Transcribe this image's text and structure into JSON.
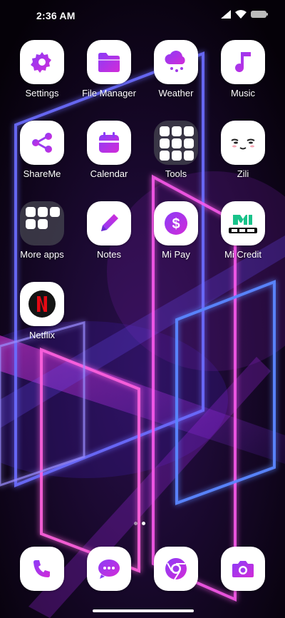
{
  "status_bar": {
    "time": "2:36 AM"
  },
  "apps": [
    {
      "label": "Settings",
      "icon": "gear-icon"
    },
    {
      "label": "File Manager",
      "icon": "folder-icon"
    },
    {
      "label": "Weather",
      "icon": "cloud-rain-icon"
    },
    {
      "label": "Music",
      "icon": "music-note-icon"
    },
    {
      "label": "ShareMe",
      "icon": "share-icon"
    },
    {
      "label": "Calendar",
      "icon": "calendar-icon"
    },
    {
      "label": "Tools",
      "icon": "folder-icon"
    },
    {
      "label": "Zili",
      "icon": "smiley-face-icon"
    },
    {
      "label": "More apps",
      "icon": "folder-icon"
    },
    {
      "label": "Notes",
      "icon": "pencil-icon"
    },
    {
      "label": "Mi Pay",
      "icon": "dollar-coin-icon"
    },
    {
      "label": "Mi Credit",
      "icon": "mi-credit-logo-icon"
    },
    {
      "label": "Netflix",
      "icon": "netflix-logo-icon"
    }
  ],
  "dock": [
    {
      "name": "Phone",
      "icon": "phone-icon"
    },
    {
      "name": "Messages",
      "icon": "chat-bubble-icon"
    },
    {
      "name": "Chrome",
      "icon": "chrome-icon"
    },
    {
      "name": "Camera",
      "icon": "camera-icon"
    }
  ],
  "pages": {
    "count": 2,
    "current": 2
  },
  "colors": {
    "accent_start": "#8b3cf7",
    "accent_end": "#d22bd8",
    "neon_blue": "#4c6bff",
    "neon_pink": "#ff4fd8",
    "netflix_red": "#e50914"
  }
}
